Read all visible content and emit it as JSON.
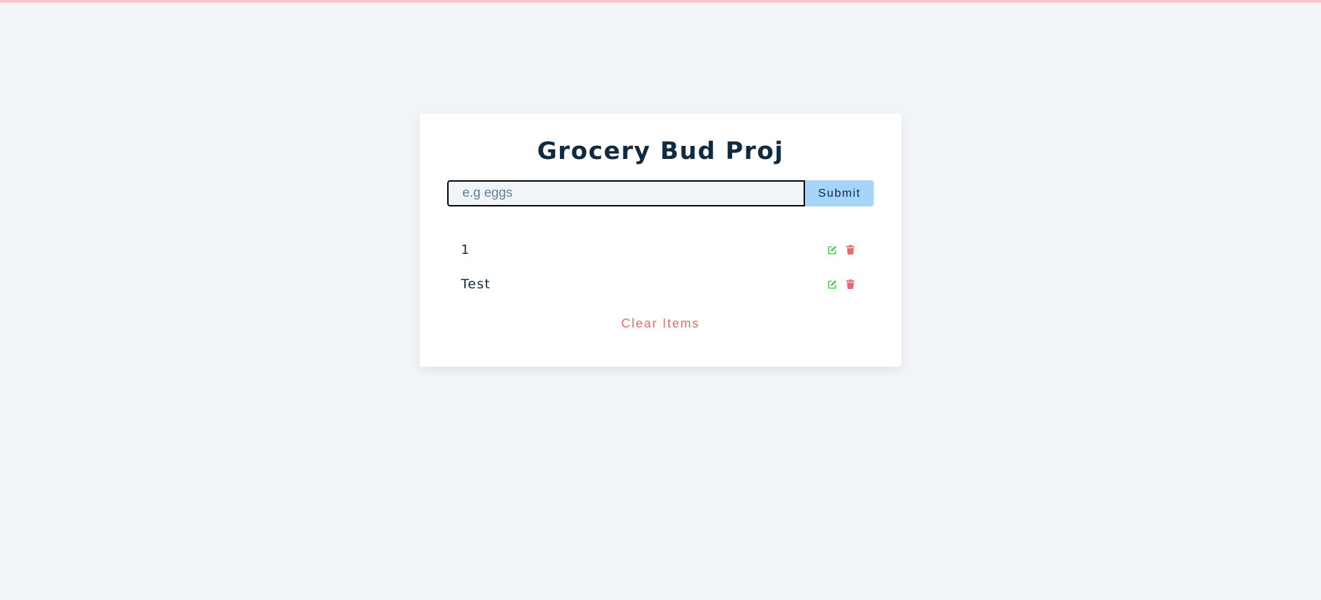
{
  "app": {
    "title": "Grocery Bud Proj"
  },
  "form": {
    "input_value": "",
    "input_placeholder": "e.g eggs",
    "submit_label": "Submit"
  },
  "list": {
    "items": [
      {
        "title": "1"
      },
      {
        "title": "Test"
      }
    ],
    "item_actions": {
      "edit_icon": "edit-icon",
      "delete_icon": "trash-icon"
    }
  },
  "footer": {
    "clear_label": "Clear Items"
  },
  "colors": {
    "background": "#f1f5f8",
    "card": "#ffffff",
    "title": "#102a42",
    "submit_bg": "#a6d5fa",
    "edit_icon": "#4ad34a",
    "delete_icon": "#e66b6b",
    "clear_text": "#e66b6b",
    "top_bar": "#f5c6cb"
  }
}
